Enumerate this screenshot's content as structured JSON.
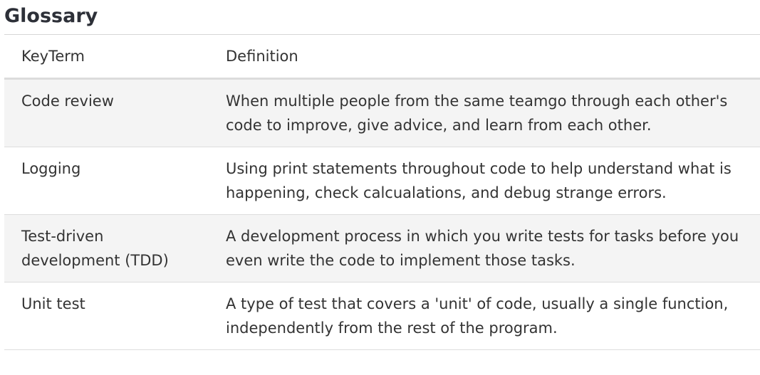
{
  "heading": "Glossary",
  "table": {
    "headers": {
      "term": "KeyTerm",
      "definition": "Definition"
    },
    "rows": [
      {
        "term": "Code review",
        "definition": "When multiple people from the same teamgo through each other's code to improve, give advice, and learn from each other."
      },
      {
        "term": "Logging",
        "definition": "Using print statements throughout code to help understand what is happening, check calcualations, and debug strange errors."
      },
      {
        "term": "Test-driven development (TDD)",
        "definition": "A development process in which you write tests for tasks before you even write the code to implement those tasks."
      },
      {
        "term": "Unit test",
        "definition": "A type of test that covers a 'unit' of code, usually a single function, independently from the rest of the program."
      }
    ]
  },
  "colors": {
    "heading": "#2d3038",
    "text": "#333333",
    "stripe": "#f4f4f4",
    "rule": "#dddddd"
  }
}
